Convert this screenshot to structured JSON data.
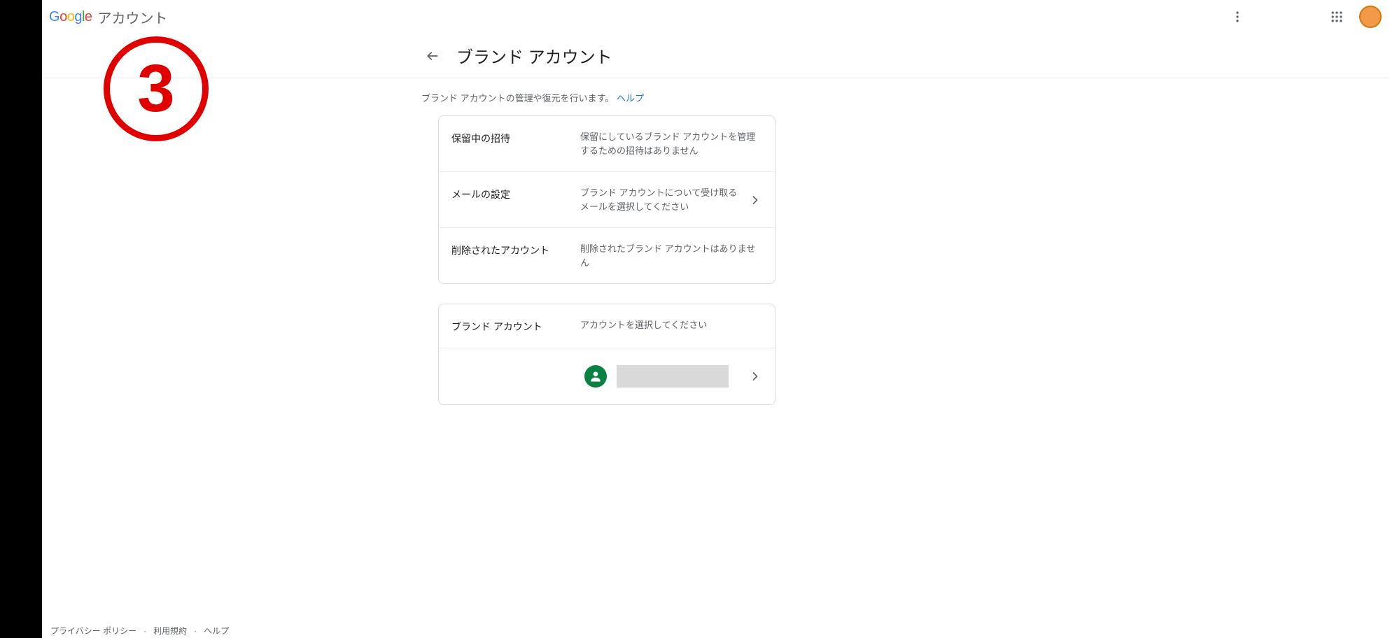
{
  "header": {
    "product_name": "アカウント"
  },
  "page": {
    "title": "ブランド アカウント",
    "description": "ブランド アカウントの管理や復元を行います。",
    "help_label": "ヘルプ"
  },
  "card1": {
    "rows": [
      {
        "label": "保留中の招待",
        "desc": "保留にしているブランド アカウントを管理するための招待はありません",
        "clickable": false
      },
      {
        "label": "メールの設定",
        "desc": "ブランド アカウントについて受け取るメールを選択してください",
        "clickable": true
      },
      {
        "label": "削除されたアカウント",
        "desc": "削除されたブランド アカウントはありません",
        "clickable": false
      }
    ]
  },
  "card2": {
    "header": {
      "label": "ブランド アカウント",
      "desc": "アカウントを選択してください"
    }
  },
  "footer": {
    "privacy": "プライバシー ポリシー",
    "terms": "利用規約",
    "help": "ヘルプ"
  },
  "overlay": {
    "number": "3"
  }
}
